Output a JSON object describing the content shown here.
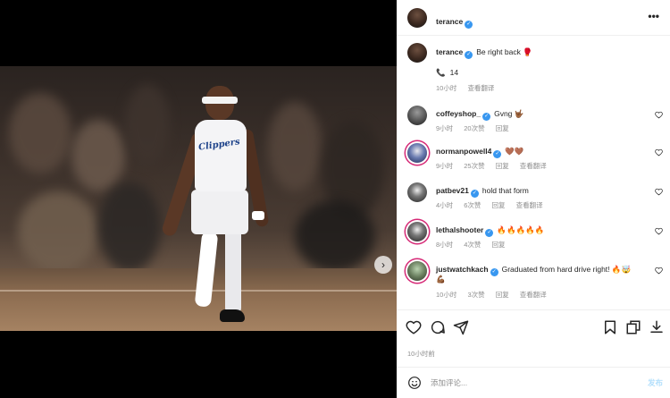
{
  "post": {
    "author": "terance",
    "verified": true,
    "caption_text": "Be right back 🥊",
    "likes_icon": "phone-icon",
    "likes_count": "14",
    "caption_time": "10小时",
    "caption_translate": "查看翻译",
    "posted_ago": "10小时前"
  },
  "media": {
    "jersey_text": "Clippers",
    "carousel_dots": 5,
    "active_dot": 0
  },
  "comments": [
    {
      "username": "coffeyshop_",
      "verified": true,
      "text": "Gvng 🤟🏾",
      "time": "9小时",
      "likes": "20次赞",
      "reply": "回复",
      "translate": ""
    },
    {
      "username": "normanpowell4",
      "verified": true,
      "text": "🤎🤎",
      "time": "9小时",
      "likes": "25次赞",
      "reply": "回复",
      "translate": "查看翻译"
    },
    {
      "username": "patbev21",
      "verified": true,
      "text": "hold that form",
      "time": "4小时",
      "likes": "6次赞",
      "reply": "回复",
      "translate": "查看翻译"
    },
    {
      "username": "lethalshooter",
      "verified": true,
      "text": "🔥🔥🔥🔥🔥",
      "time": "8小时",
      "likes": "4次赞",
      "reply": "回复",
      "translate": ""
    },
    {
      "username": "justwatchkach",
      "verified": true,
      "text": "Graduated from hard drive right! 🔥🤯",
      "text2": "💪🏾",
      "time": "10小时",
      "likes": "3次赞",
      "reply": "回复",
      "translate": "查看翻译"
    }
  ],
  "composer": {
    "placeholder": "添加评论...",
    "post_label": "发布"
  },
  "colors": {
    "verified_blue": "#3897f0",
    "meta_gray": "#8e8e8e",
    "story_ring": "#d62976"
  }
}
